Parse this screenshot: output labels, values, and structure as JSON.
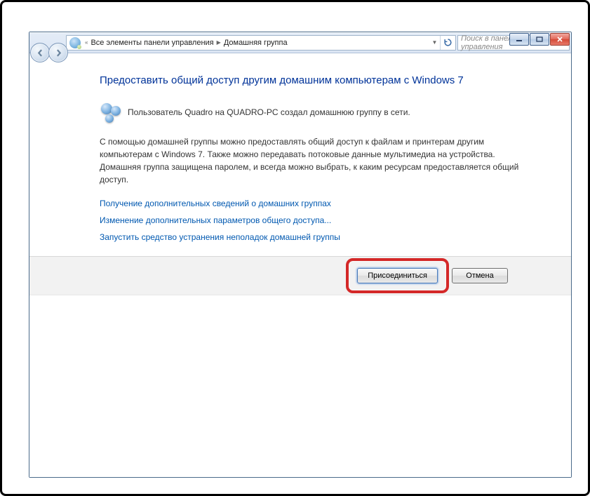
{
  "caption_buttons": {
    "minimize": "minimize",
    "maximize": "maximize",
    "close": "close"
  },
  "address_bar": {
    "root_marker": "«",
    "segment1": "Все элементы панели управления",
    "segment2": "Домашняя группа"
  },
  "search": {
    "placeholder": "Поиск в панели управления"
  },
  "page": {
    "heading": "Предоставить общий доступ другим домашним компьютерам с Windows 7",
    "info_line": "Пользователь Quadro на QUADRO-PC создал домашнюю группу в сети.",
    "description": "С помощью домашней группы можно предоставлять общий доступ к файлам и принтерам другим компьютерам с Windows 7. Также можно передавать потоковые данные мультимедиа на устройства. Домашняя группа защищена паролем, и всегда можно выбрать, к каким ресурсам предоставляется общий доступ.",
    "links": {
      "learn_more": "Получение дополнительных сведений о домашних группах",
      "advanced_sharing": "Изменение дополнительных параметров общего доступа...",
      "troubleshoot": "Запустить средство устранения неполадок домашней группы"
    },
    "buttons": {
      "join": "Присоединиться",
      "cancel": "Отмена"
    }
  }
}
